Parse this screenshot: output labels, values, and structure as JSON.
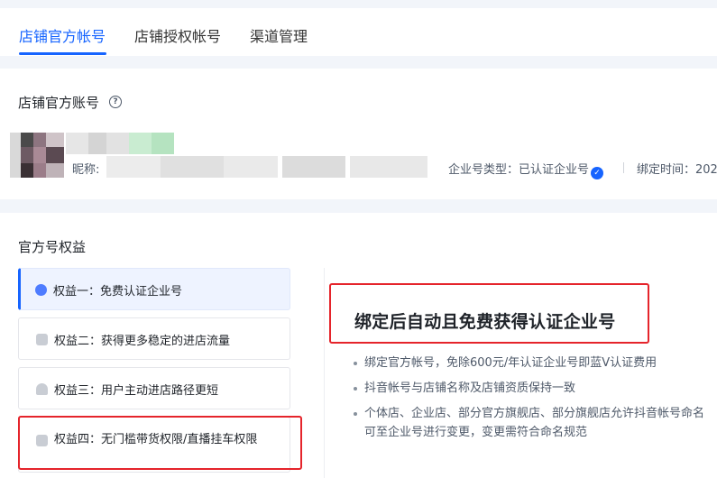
{
  "tabs": [
    {
      "label": "店铺官方帐号",
      "active": true
    },
    {
      "label": "店铺授权帐号",
      "active": false
    },
    {
      "label": "渠道管理",
      "active": false
    }
  ],
  "account": {
    "section_title": "店铺官方账号",
    "help_icon": "?",
    "nickname_label": "昵称:",
    "type_label": "企业号类型：",
    "type_value": "已认证企业号",
    "verified_icon": "✓",
    "bind_time_label": "绑定时间：202"
  },
  "benefits": {
    "section_title": "官方号权益",
    "items": [
      {
        "label": "权益一：免费认证企业号",
        "active": true
      },
      {
        "label": "权益二：获得更多稳定的进店流量",
        "active": false
      },
      {
        "label": "权益三：用户主动进店路径更短",
        "active": false
      },
      {
        "label": "权益四：无门槛带货权限/直播挂车权限",
        "active": false
      }
    ],
    "detail": {
      "headline": "绑定后自动且免费获得认证企业号",
      "bullets": [
        "绑定官方帐号，免除600元/年认证企业号即蓝V认证费用",
        "抖音帐号与店铺名称及店铺资质保持一致",
        "个体店、企业店、部分官方旗舰店、部分旗舰店允许抖音帐号命名可至企业号进行变更，变更需符合命名规范"
      ]
    }
  },
  "colors": {
    "accent": "#1664ff",
    "highlight_box": "#e5242b",
    "page_bg": "#f2f5fa"
  }
}
